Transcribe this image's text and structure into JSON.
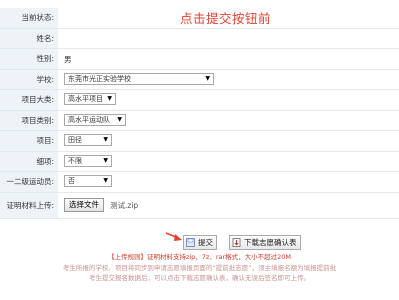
{
  "annotation": {
    "headline": "点击提交按钮前"
  },
  "form": {
    "rows": [
      {
        "label": "当前状态:",
        "value": ""
      },
      {
        "label": "姓名:",
        "value": ""
      },
      {
        "label": "性别:",
        "value": "男"
      },
      {
        "label": "学校:",
        "value": "东莞市光正实验学校"
      },
      {
        "label": "项目大类:",
        "value": "高水平项目"
      },
      {
        "label": "项目类别:",
        "value": "高水平运动队"
      },
      {
        "label": "项目:",
        "value": "田径"
      },
      {
        "label": "细项:",
        "value": "不限"
      },
      {
        "label": "一二级运动员:",
        "value": "否"
      },
      {
        "label": "证明材料上传:",
        "file_button": "选择文件",
        "file_name": "测试.zip"
      }
    ]
  },
  "actions": {
    "submit_label": "提交",
    "download_label": "下载志愿确认表"
  },
  "notes": {
    "line1": "【上传规则】证明材料支持zip、7z、rar格式，大小不超过20M",
    "line2": "考生所报的学校、项目将同步到申请志愿填报页面的“提前批志愿”，须主填报名额为填报提前批",
    "line3": "考生提交报名数据后，可以点击下载志愿确认表，确认无误后签名即可上传。"
  },
  "colors": {
    "accent_red": "#e5412f",
    "label_bg": "#eef3f8"
  }
}
